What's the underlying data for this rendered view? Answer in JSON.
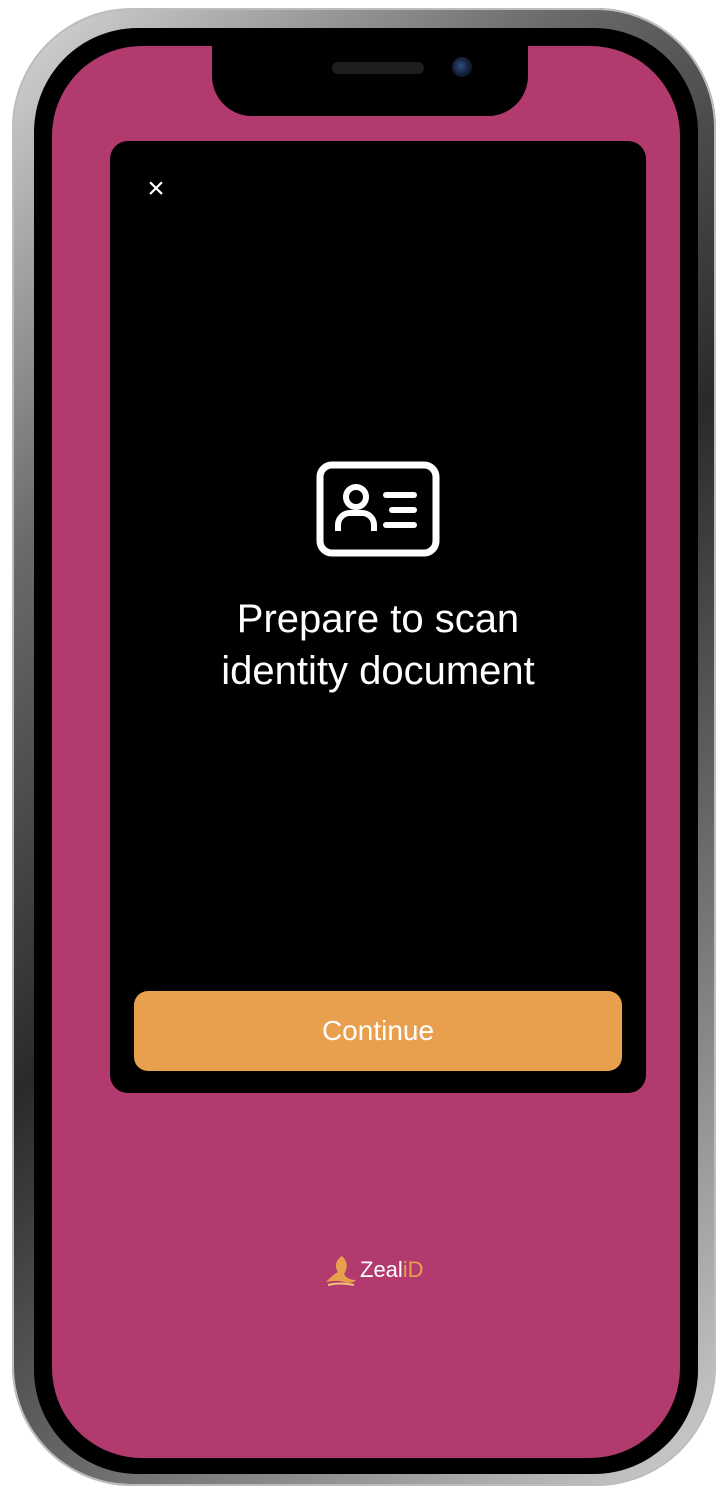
{
  "close": {
    "glyph": "×"
  },
  "content": {
    "icon": "id-card-icon",
    "title_line1": "Prepare to scan",
    "title_line2": "identity document"
  },
  "actions": {
    "continue_label": "Continue"
  },
  "brand": {
    "name_part1": "Zeal",
    "name_part2": "iD"
  },
  "colors": {
    "background": "#b23a6e",
    "card": "#000000",
    "accent": "#e8a04e",
    "text": "#ffffff"
  }
}
